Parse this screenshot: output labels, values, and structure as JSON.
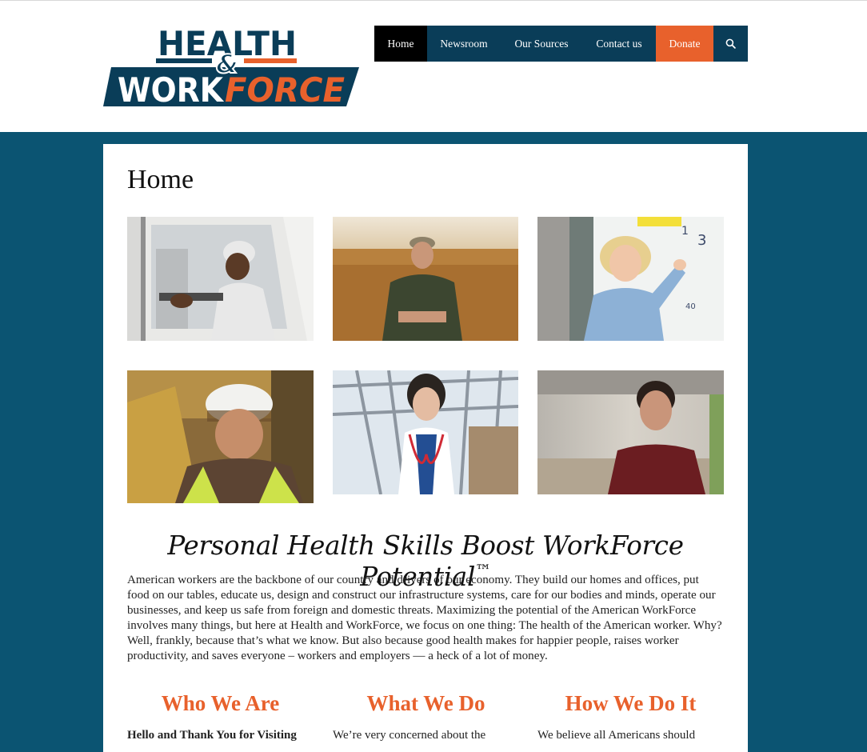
{
  "logo": {
    "line1": "HEALTH",
    "amp": "&",
    "line2_a": "WORK",
    "line2_b": "FORCE",
    "colors": {
      "navy": "#0a3d58",
      "orange": "#e8612c"
    }
  },
  "nav": {
    "items": [
      {
        "label": "Home",
        "active": true
      },
      {
        "label": "Newsroom"
      },
      {
        "label": "Our Sources"
      },
      {
        "label": "Contact us"
      },
      {
        "label": "Donate"
      }
    ],
    "search_icon": "search-icon"
  },
  "page": {
    "title": "Home",
    "photos": [
      {
        "subject": "delivery-truck-driver"
      },
      {
        "subject": "farmer-in-field"
      },
      {
        "subject": "teacher-at-whiteboard"
      },
      {
        "subject": "construction-worker"
      },
      {
        "subject": "doctor"
      },
      {
        "subject": "office-worker"
      }
    ],
    "tagline": "Personal Health Skills Boost WorkForce Potential",
    "tagline_mark": "™",
    "intro": "American workers are the backbone of our country and drivers of our economy.  They build our homes and offices, put food on our tables, educate us, design and construct our infrastructure systems, care for our bodies and minds, operate our businesses, and keep us safe from foreign and domestic threats.   Maximizing the potential of the American WorkForce involves many things, but here at Health and WorkForce, we focus on one thing:  The health of the American worker.  Why?  Well, frankly, because that’s what we know. But also because good health makes for happier people, raises worker productivity, and saves everyone – workers and employers — a heck of a lot of money.",
    "columns": [
      {
        "heading": "Who We Are",
        "text": "Hello and Thank You for Visiting"
      },
      {
        "heading": "What We Do",
        "text": "We’re very concerned about the"
      },
      {
        "heading": "How We Do It",
        "text": "We believe all Americans should"
      }
    ]
  },
  "colors": {
    "brand_blue": "#0b5472",
    "accent_orange": "#e8612c",
    "nav_dark": "#0a3d58"
  }
}
